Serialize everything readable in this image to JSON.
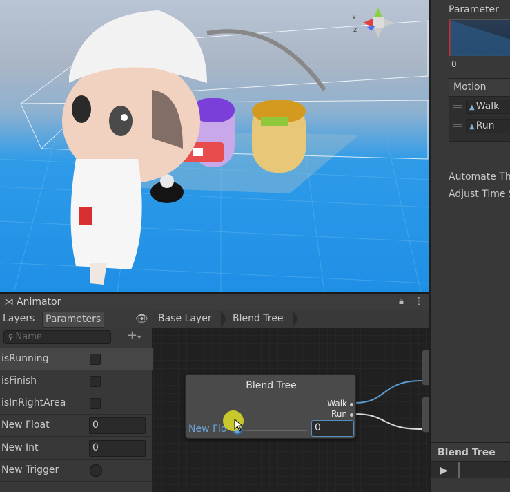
{
  "colors": {
    "accent": "#6aa3d8",
    "graph_bg": "#202020",
    "panel_bg": "#383838",
    "cursor_highlight": "#dede28"
  },
  "inspector": {
    "parameter_label": "Parameter",
    "graph_min": "0",
    "motion_header": "Motion",
    "motions": [
      {
        "icon": "animation-clip-icon",
        "label": "Walk"
      },
      {
        "icon": "animation-clip-icon",
        "label": "Run"
      }
    ],
    "automate_label": "Automate Th",
    "adjust_label": "Adjust Time S",
    "preview_title": "Blend Tree",
    "play_icon": "play-icon"
  },
  "animator": {
    "window_title": "Animator",
    "tabs": [
      {
        "label": "Layers"
      },
      {
        "label": "Parameters",
        "active": true
      }
    ],
    "search_placeholder": "Name",
    "parameters": [
      {
        "name": "isRunning",
        "type": "bool",
        "selected": true
      },
      {
        "name": "isFinish",
        "type": "bool"
      },
      {
        "name": "isInRightArea",
        "type": "bool"
      },
      {
        "name": "New Float",
        "type": "float",
        "value": "0"
      },
      {
        "name": "New Int",
        "type": "int",
        "value": "0"
      },
      {
        "name": "New Trigger",
        "type": "trigger"
      }
    ],
    "breadcrumb": [
      "Base Layer",
      "Blend Tree"
    ],
    "node": {
      "title": "Blend Tree",
      "outputs": [
        "Walk",
        "Run"
      ],
      "param_label": "New Flo",
      "value": "0",
      "slider_fraction": 0
    }
  }
}
